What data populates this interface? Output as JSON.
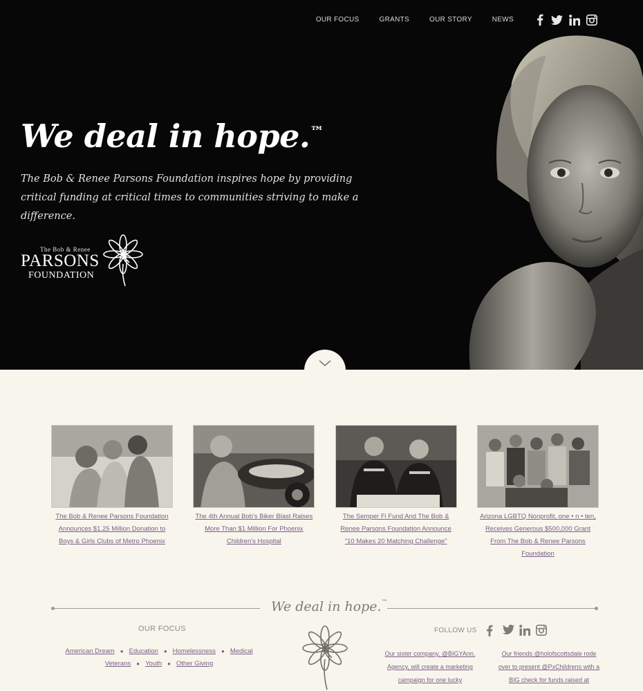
{
  "nav": {
    "links": [
      "OUR FOCUS",
      "GRANTS",
      "OUR STORY",
      "NEWS"
    ],
    "social_icons": [
      "facebook-icon",
      "twitter-icon",
      "linkedin-icon",
      "instagram-icon"
    ]
  },
  "hero": {
    "headline": "We deal in hope.",
    "trademark": "™",
    "tagline": "The Bob & Renee Parsons Foundation inspires hope by providing critical funding at critical times to communities striving to make a difference.",
    "logo": {
      "line1": "The Bob & Renee",
      "line2": "PARSONS",
      "line3": "FOUNDATION"
    }
  },
  "news": [
    {
      "title": "The Bob & Renee Parsons Foundation Announces $1.25 Million Donation to Boys & Girls Clubs of Metro Phoenix"
    },
    {
      "title": "The 4th Annual Bob's Biker Blast Raises More Than $1 Million For Phoenix Children's Hospital"
    },
    {
      "title": "The Semper Fi Fund And The Bob & Renee Parsons Foundation Announce \"10 Makes 20 Matching Challenge\""
    },
    {
      "title": "Arizona LGBTQ Nonprofit, one • n • ten, Receives Generous $500,000 Grant From The Bob & Renee Parsons Foundation"
    }
  ],
  "footer": {
    "tagline": "We deal in hope.",
    "trademark": "™",
    "focus_title": "OUR FOCUS",
    "focus_links": [
      "American Dream",
      "Education",
      "Homelessness",
      "Medical",
      "Veterans",
      "Youth",
      "Other Giving"
    ],
    "follow_label": "FOLLOW US",
    "tweets": [
      "Our sister company, @BIGYAnn. Agency, will create a marketing campaign for one lucky",
      "Our friends @holofscottsdale rode over to present @PxChildrens with a BIG check for funds raised at"
    ]
  },
  "colors": {
    "hero_bg": "#070707",
    "page_bg": "#f8f6ec",
    "link": "#7a5c85",
    "muted_text": "#8b8b84"
  }
}
